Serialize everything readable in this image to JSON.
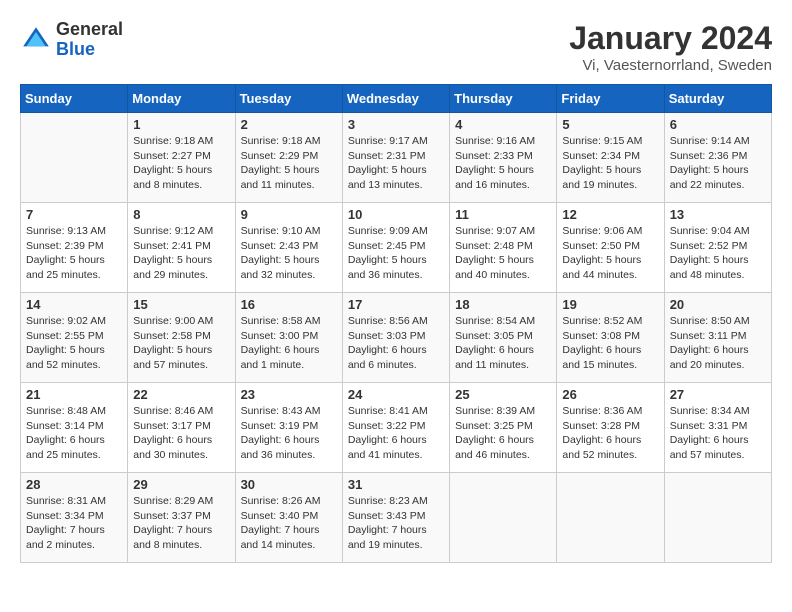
{
  "header": {
    "logo_line1": "General",
    "logo_line2": "Blue",
    "month": "January 2024",
    "location": "Vi, Vaesternorrland, Sweden"
  },
  "weekdays": [
    "Sunday",
    "Monday",
    "Tuesday",
    "Wednesday",
    "Thursday",
    "Friday",
    "Saturday"
  ],
  "weeks": [
    [
      {
        "day": "",
        "info": ""
      },
      {
        "day": "1",
        "info": "Sunrise: 9:18 AM\nSunset: 2:27 PM\nDaylight: 5 hours\nand 8 minutes."
      },
      {
        "day": "2",
        "info": "Sunrise: 9:18 AM\nSunset: 2:29 PM\nDaylight: 5 hours\nand 11 minutes."
      },
      {
        "day": "3",
        "info": "Sunrise: 9:17 AM\nSunset: 2:31 PM\nDaylight: 5 hours\nand 13 minutes."
      },
      {
        "day": "4",
        "info": "Sunrise: 9:16 AM\nSunset: 2:33 PM\nDaylight: 5 hours\nand 16 minutes."
      },
      {
        "day": "5",
        "info": "Sunrise: 9:15 AM\nSunset: 2:34 PM\nDaylight: 5 hours\nand 19 minutes."
      },
      {
        "day": "6",
        "info": "Sunrise: 9:14 AM\nSunset: 2:36 PM\nDaylight: 5 hours\nand 22 minutes."
      }
    ],
    [
      {
        "day": "7",
        "info": "Sunrise: 9:13 AM\nSunset: 2:39 PM\nDaylight: 5 hours\nand 25 minutes."
      },
      {
        "day": "8",
        "info": "Sunrise: 9:12 AM\nSunset: 2:41 PM\nDaylight: 5 hours\nand 29 minutes."
      },
      {
        "day": "9",
        "info": "Sunrise: 9:10 AM\nSunset: 2:43 PM\nDaylight: 5 hours\nand 32 minutes."
      },
      {
        "day": "10",
        "info": "Sunrise: 9:09 AM\nSunset: 2:45 PM\nDaylight: 5 hours\nand 36 minutes."
      },
      {
        "day": "11",
        "info": "Sunrise: 9:07 AM\nSunset: 2:48 PM\nDaylight: 5 hours\nand 40 minutes."
      },
      {
        "day": "12",
        "info": "Sunrise: 9:06 AM\nSunset: 2:50 PM\nDaylight: 5 hours\nand 44 minutes."
      },
      {
        "day": "13",
        "info": "Sunrise: 9:04 AM\nSunset: 2:52 PM\nDaylight: 5 hours\nand 48 minutes."
      }
    ],
    [
      {
        "day": "14",
        "info": "Sunrise: 9:02 AM\nSunset: 2:55 PM\nDaylight: 5 hours\nand 52 minutes."
      },
      {
        "day": "15",
        "info": "Sunrise: 9:00 AM\nSunset: 2:58 PM\nDaylight: 5 hours\nand 57 minutes."
      },
      {
        "day": "16",
        "info": "Sunrise: 8:58 AM\nSunset: 3:00 PM\nDaylight: 6 hours\nand 1 minute."
      },
      {
        "day": "17",
        "info": "Sunrise: 8:56 AM\nSunset: 3:03 PM\nDaylight: 6 hours\nand 6 minutes."
      },
      {
        "day": "18",
        "info": "Sunrise: 8:54 AM\nSunset: 3:05 PM\nDaylight: 6 hours\nand 11 minutes."
      },
      {
        "day": "19",
        "info": "Sunrise: 8:52 AM\nSunset: 3:08 PM\nDaylight: 6 hours\nand 15 minutes."
      },
      {
        "day": "20",
        "info": "Sunrise: 8:50 AM\nSunset: 3:11 PM\nDaylight: 6 hours\nand 20 minutes."
      }
    ],
    [
      {
        "day": "21",
        "info": "Sunrise: 8:48 AM\nSunset: 3:14 PM\nDaylight: 6 hours\nand 25 minutes."
      },
      {
        "day": "22",
        "info": "Sunrise: 8:46 AM\nSunset: 3:17 PM\nDaylight: 6 hours\nand 30 minutes."
      },
      {
        "day": "23",
        "info": "Sunrise: 8:43 AM\nSunset: 3:19 PM\nDaylight: 6 hours\nand 36 minutes."
      },
      {
        "day": "24",
        "info": "Sunrise: 8:41 AM\nSunset: 3:22 PM\nDaylight: 6 hours\nand 41 minutes."
      },
      {
        "day": "25",
        "info": "Sunrise: 8:39 AM\nSunset: 3:25 PM\nDaylight: 6 hours\nand 46 minutes."
      },
      {
        "day": "26",
        "info": "Sunrise: 8:36 AM\nSunset: 3:28 PM\nDaylight: 6 hours\nand 52 minutes."
      },
      {
        "day": "27",
        "info": "Sunrise: 8:34 AM\nSunset: 3:31 PM\nDaylight: 6 hours\nand 57 minutes."
      }
    ],
    [
      {
        "day": "28",
        "info": "Sunrise: 8:31 AM\nSunset: 3:34 PM\nDaylight: 7 hours\nand 2 minutes."
      },
      {
        "day": "29",
        "info": "Sunrise: 8:29 AM\nSunset: 3:37 PM\nDaylight: 7 hours\nand 8 minutes."
      },
      {
        "day": "30",
        "info": "Sunrise: 8:26 AM\nSunset: 3:40 PM\nDaylight: 7 hours\nand 14 minutes."
      },
      {
        "day": "31",
        "info": "Sunrise: 8:23 AM\nSunset: 3:43 PM\nDaylight: 7 hours\nand 19 minutes."
      },
      {
        "day": "",
        "info": ""
      },
      {
        "day": "",
        "info": ""
      },
      {
        "day": "",
        "info": ""
      }
    ]
  ]
}
